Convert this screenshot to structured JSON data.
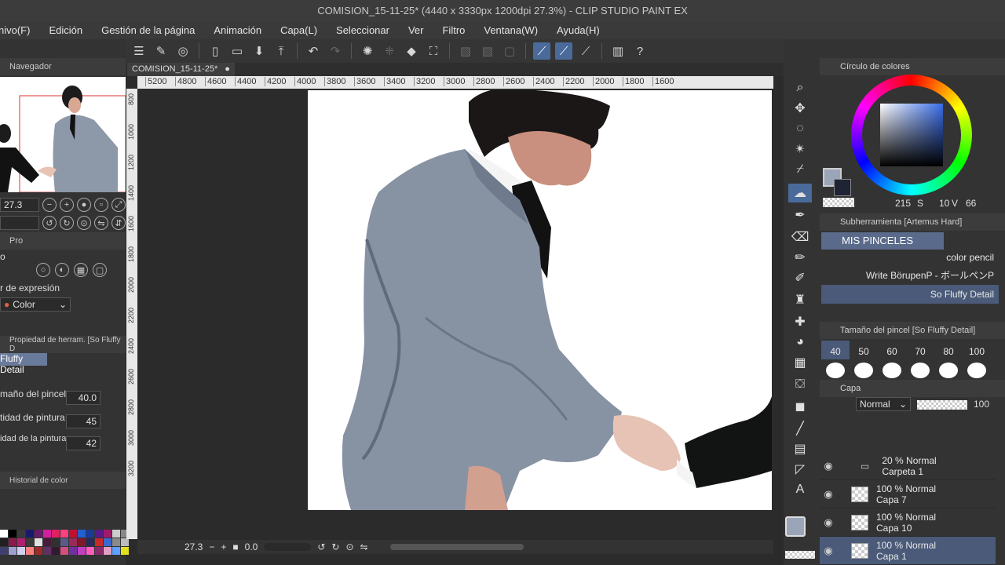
{
  "window": {
    "title": "COMISION_15-11-25* (4440 x 3330px 1200dpi 27.3%) - CLIP STUDIO PAINT EX"
  },
  "menu": [
    "nivo(F)",
    "Edición",
    "Gestión de la página",
    "Animación",
    "Capa(L)",
    "Seleccionar",
    "Ver",
    "Filtro",
    "Ventana(W)",
    "Ayuda(H)"
  ],
  "navigator": {
    "title": "Navegador",
    "zoom": "27.3"
  },
  "left_panel": {
    "tab_short": "Pro",
    "section_label": "o",
    "expression_label": "r de expresión",
    "expression_value": "Color",
    "tool_property_title": "Propiedad de herram. [So Fluffy D",
    "brush_name": "Fluffy Detail",
    "props": [
      {
        "label": "maño del pincel",
        "value": "40.0"
      },
      {
        "label": "tidad de pintura",
        "value": "45"
      },
      {
        "label": "idad de la pintura",
        "value": "42"
      }
    ],
    "color_history_title": "Historial de color"
  },
  "canvas": {
    "tab_label": "COMISION_15-11-25*",
    "ruler_ticks": [
      "5200",
      "4800",
      "4600",
      "4400",
      "4200",
      "4000",
      "3800",
      "3600",
      "3400",
      "3200",
      "3000",
      "2800",
      "2600",
      "2400",
      "2200",
      "2000",
      "1800",
      "1600"
    ],
    "vruler_ticks": [
      "800",
      "1000",
      "1200",
      "1400",
      "1600",
      "1800",
      "2000",
      "2200",
      "2400",
      "2600",
      "2800",
      "3000",
      "3200"
    ],
    "status_zoom": "27.3",
    "status_angle": "0.0"
  },
  "color_wheel": {
    "title": "Círculo de colores",
    "h": "215",
    "s_label": "S",
    "s": "10",
    "v_label": "V",
    "v": "66",
    "main_color": "#9aa6b8",
    "sub_color": "#1e2433"
  },
  "subtool": {
    "title": "Subherramienta [Artemus Hard]",
    "group": "MIS PINCELES",
    "brushes": [
      "color pencil",
      "Write BörupenP - ボールペンP",
      "So Fluffy Detail"
    ]
  },
  "brush_size": {
    "title": "Tamaño del pincel [So Fluffy Detail]",
    "sizes": [
      "40",
      "50",
      "60",
      "70",
      "80",
      "100"
    ]
  },
  "layers": {
    "title": "Capa",
    "blend_mode": "Normal",
    "opacity": "100",
    "items": [
      {
        "opacity_mode": "20 % Normal",
        "name": "Carpeta 1"
      },
      {
        "opacity_mode": "100 % Normal",
        "name": "Capa 7"
      },
      {
        "opacity_mode": "100 % Normal",
        "name": "Capa 10"
      },
      {
        "opacity_mode": "100 % Normal",
        "name": "Capa 1"
      }
    ]
  },
  "palette_colors": [
    "#ffffff",
    "#000000",
    "#3a3a3a",
    "#1a1a6a",
    "#6a1a6a",
    "#d020a0",
    "#e02060",
    "#ff4080",
    "#c01030",
    "#2060d0",
    "#1a3a9a",
    "#5a1a8a",
    "#a01a6a",
    "#cccccc",
    "#888888",
    "#202020",
    "#8a1a4a",
    "#b02070",
    "#3a3a3a",
    "#e0e0e0",
    "#4a1a3a",
    "#303030",
    "#5a5a8a",
    "#9a2a5a",
    "#7a1a2a",
    "#2a2a5a",
    "#c82a2a",
    "#3a6ad0",
    "#8a8a8a",
    "#bcbcbc",
    "#404070",
    "#a0a0d0",
    "#d0d0f0",
    "#ff8080",
    "#a02a2a",
    "#603060",
    "#301a30",
    "#d05080",
    "#7030a0",
    "#c040c0",
    "#ff60c0",
    "#8a2a6a",
    "#e0a0c0",
    "#60a0ff",
    "#e0e020"
  ]
}
